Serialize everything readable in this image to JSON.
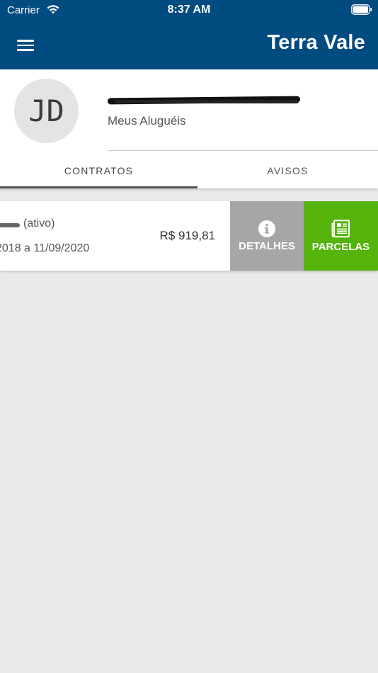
{
  "status_bar": {
    "carrier": "Carrier",
    "time": "8:37 AM"
  },
  "navbar": {
    "title": "Terra Vale",
    "menu_icon": "hamburger-menu-icon"
  },
  "profile": {
    "initials": "JD",
    "subtitle": "Meus Aluguéis"
  },
  "tabs": [
    {
      "label": "CONTRATOS",
      "selected": true
    },
    {
      "label": "AVISOS",
      "selected": false
    }
  ],
  "contract": {
    "status": "(ativo)",
    "period": "2018 a 11/09/2020",
    "value": "R$ 919,81",
    "actions": {
      "details_label": "DETALHES",
      "details_icon": "info-icon",
      "details_color": "#a6a6a6",
      "installments_label": "PARCELAS",
      "installments_icon": "receipt-icon",
      "installments_color": "#54b40b"
    }
  },
  "colors": {
    "primary": "#004b80",
    "background": "#e9e9e9"
  }
}
